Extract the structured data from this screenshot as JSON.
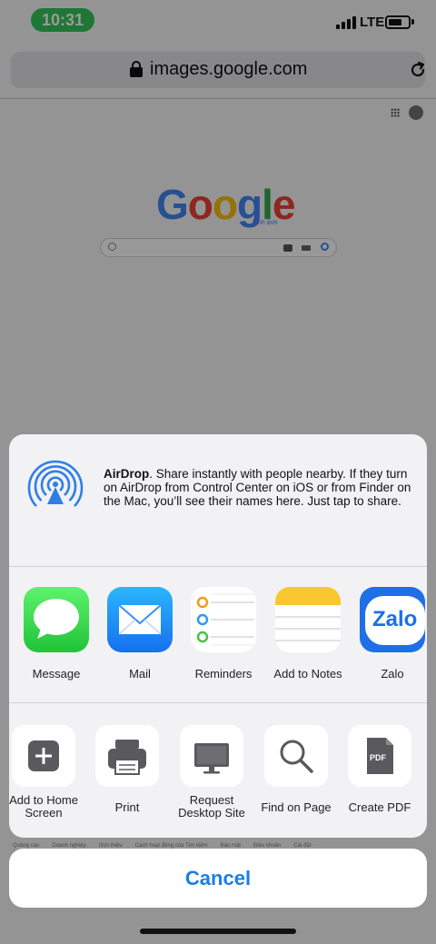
{
  "status_bar": {
    "time": "10:31",
    "network": "LTE"
  },
  "browser": {
    "url": "images.google.com"
  },
  "google": {
    "logo_letters": [
      {
        "char": "G",
        "color": "#4285f4"
      },
      {
        "char": "o",
        "color": "#ea4335"
      },
      {
        "char": "o",
        "color": "#fbbc05"
      },
      {
        "char": "g",
        "color": "#4285f4"
      },
      {
        "char": "l",
        "color": "#34a853"
      },
      {
        "char": "e",
        "color": "#ea4335"
      }
    ],
    "sub": "hình ảnh",
    "footer_links": [
      "Quảng cáo",
      "Doanh nghiệp",
      "Giới thiệu",
      "Cách hoạt động của Tìm kiếm",
      "Bảo mật",
      "Điều khoản",
      "Cài đặt"
    ]
  },
  "share_sheet": {
    "airdrop": {
      "title": "AirDrop",
      "text": ". Share instantly with people nearby. If they turn on AirDrop from Control Center on iOS or from Finder on the Mac, you’ll see their names here. Just tap to share."
    },
    "apps": [
      {
        "label": "Message",
        "icon": "message-icon"
      },
      {
        "label": "Mail",
        "icon": "mail-icon"
      },
      {
        "label": "Reminders",
        "icon": "reminders-icon"
      },
      {
        "label": "Add to Notes",
        "icon": "notes-icon"
      },
      {
        "label": "Zalo",
        "icon": "zalo-icon",
        "icon_text": "Zalo"
      }
    ],
    "actions": [
      {
        "label": "Add to Home Screen",
        "icon": "plus-icon"
      },
      {
        "label": "Print",
        "icon": "printer-icon"
      },
      {
        "label": "Request Desktop Site",
        "icon": "desktop-icon"
      },
      {
        "label": "Find on Page",
        "icon": "magnifier-icon"
      },
      {
        "label": "Create PDF",
        "icon": "pdf-icon",
        "icon_text": "PDF"
      }
    ]
  },
  "cancel_label": "Cancel",
  "colors": {
    "accent": "#1a7ee6",
    "time_pill": "#34c759",
    "airdrop": "#2f7fe3"
  }
}
